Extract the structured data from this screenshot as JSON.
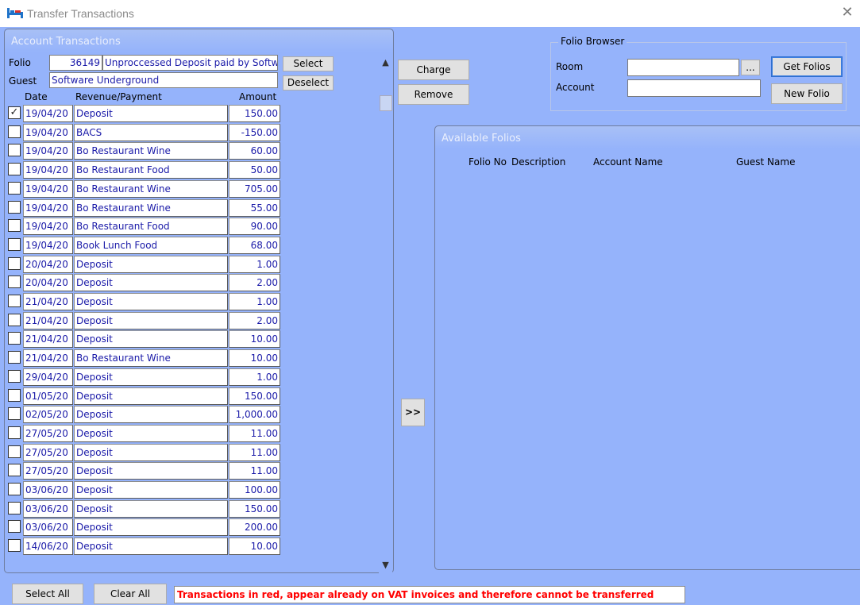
{
  "window": {
    "title": "Transfer Transactions"
  },
  "account_panel": {
    "caption": "Account Transactions",
    "folio_label": "Folio",
    "folio_number": "36149",
    "folio_description": "Unproccessed Deposit paid by Softw",
    "guest_label": "Guest",
    "guest_name": "Software Underground",
    "select_label": "Select",
    "deselect_label": "Deselect",
    "columns": {
      "date": "Date",
      "revenue": "Revenue/Payment",
      "amount": "Amount"
    },
    "rows": [
      {
        "checked": true,
        "date": "19/04/20",
        "desc": "Deposit",
        "amount": "150.00"
      },
      {
        "checked": false,
        "date": "19/04/20",
        "desc": "BACS",
        "amount": "-150.00"
      },
      {
        "checked": false,
        "date": "19/04/20",
        "desc": "Bo Restaurant Wine",
        "amount": "60.00"
      },
      {
        "checked": false,
        "date": "19/04/20",
        "desc": "Bo Restaurant Food",
        "amount": "50.00"
      },
      {
        "checked": false,
        "date": "19/04/20",
        "desc": "Bo Restaurant Wine",
        "amount": "705.00"
      },
      {
        "checked": false,
        "date": "19/04/20",
        "desc": "Bo Restaurant Wine",
        "amount": "55.00"
      },
      {
        "checked": false,
        "date": "19/04/20",
        "desc": "Bo Restaurant Food",
        "amount": "90.00"
      },
      {
        "checked": false,
        "date": "19/04/20",
        "desc": "Book Lunch Food",
        "amount": "68.00"
      },
      {
        "checked": false,
        "date": "20/04/20",
        "desc": "Deposit",
        "amount": "1.00"
      },
      {
        "checked": false,
        "date": "20/04/20",
        "desc": "Deposit",
        "amount": "2.00"
      },
      {
        "checked": false,
        "date": "21/04/20",
        "desc": "Deposit",
        "amount": "1.00"
      },
      {
        "checked": false,
        "date": "21/04/20",
        "desc": "Deposit",
        "amount": "2.00"
      },
      {
        "checked": false,
        "date": "21/04/20",
        "desc": "Deposit",
        "amount": "10.00"
      },
      {
        "checked": false,
        "date": "21/04/20",
        "desc": "Bo Restaurant Wine",
        "amount": "10.00"
      },
      {
        "checked": false,
        "date": "29/04/20",
        "desc": "Deposit",
        "amount": "1.00"
      },
      {
        "checked": false,
        "date": "01/05/20",
        "desc": "Deposit",
        "amount": "150.00"
      },
      {
        "checked": false,
        "date": "02/05/20",
        "desc": "Deposit",
        "amount": "1,000.00"
      },
      {
        "checked": false,
        "date": "27/05/20",
        "desc": "Deposit",
        "amount": "11.00"
      },
      {
        "checked": false,
        "date": "27/05/20",
        "desc": "Deposit",
        "amount": "11.00"
      },
      {
        "checked": false,
        "date": "27/05/20",
        "desc": "Deposit",
        "amount": "11.00"
      },
      {
        "checked": false,
        "date": "03/06/20",
        "desc": "Deposit",
        "amount": "100.00"
      },
      {
        "checked": false,
        "date": "03/06/20",
        "desc": "Deposit",
        "amount": "150.00"
      },
      {
        "checked": false,
        "date": "03/06/20",
        "desc": "Deposit",
        "amount": "200.00"
      },
      {
        "checked": false,
        "date": "14/06/20",
        "desc": "Deposit",
        "amount": "10.00"
      }
    ]
  },
  "actions": {
    "charge_label": "Charge",
    "remove_label": "Remove",
    "transfer_label": ">>"
  },
  "folio_browser": {
    "legend": "Folio Browser",
    "room_label": "Room",
    "room_value": "",
    "ellipsis_label": "...",
    "account_label": "Account",
    "account_value": "",
    "get_folios_label": "Get Folios",
    "new_folio_label": "New Folio"
  },
  "available_folios": {
    "caption": "Available Folios",
    "columns": {
      "folio_no": "Folio No",
      "description": "Description",
      "account_name": "Account Name",
      "guest_name": "Guest Name"
    }
  },
  "footer": {
    "select_all_label": "Select All",
    "clear_all_label": "Clear All",
    "status_message": "Transactions in red, appear already on VAT invoices and therefore cannot be transferred"
  },
  "colors": {
    "background": "#95b3fb",
    "row_text": "#1a1aa8",
    "status_text": "#ff0000"
  }
}
